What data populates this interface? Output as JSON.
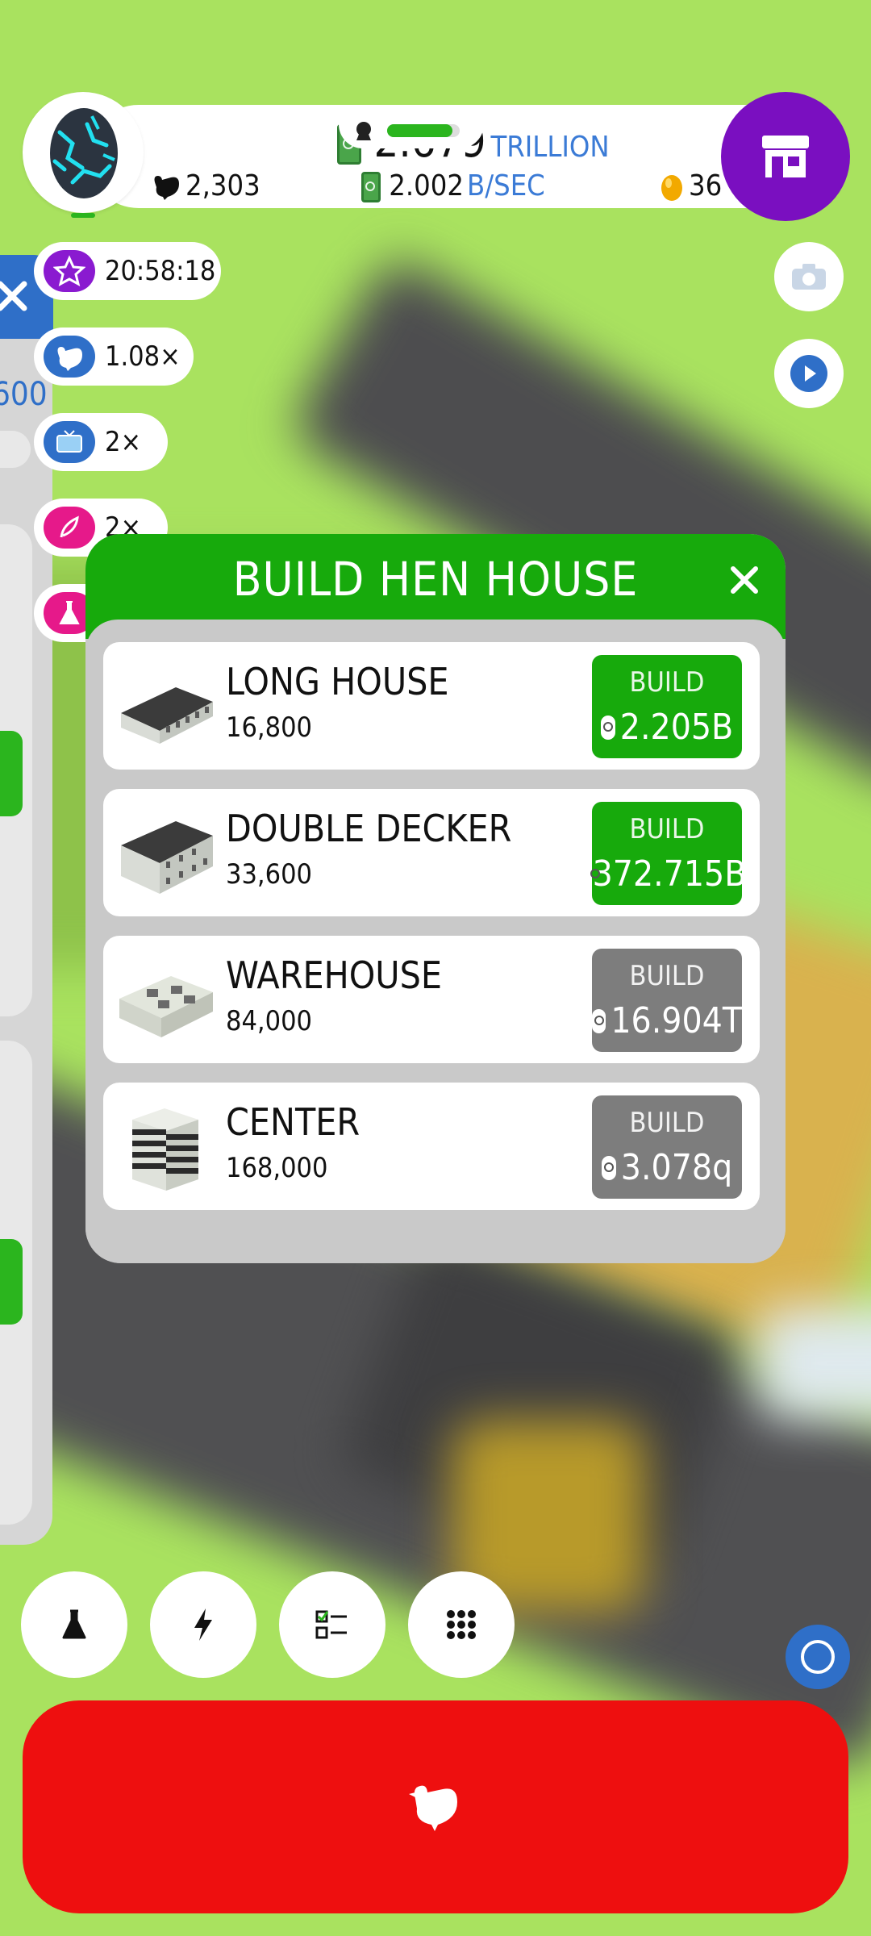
{
  "hud": {
    "money": "2.679",
    "money_unit": "TRILLION",
    "rate": "2.002",
    "rate_unit": "B/SEC",
    "chickens": "2,303",
    "golden_eggs": "36",
    "hab_fill_fraction": 0.9
  },
  "boosts": [
    {
      "name": "star-boost",
      "value": "20:58:18",
      "color": "#8a1ad0"
    },
    {
      "name": "chicken-boost",
      "value": "1.08×",
      "color": "#2f6fc8"
    },
    {
      "name": "tv-boost",
      "value": "2×",
      "color": "#2f6fc8"
    },
    {
      "name": "feather-boost",
      "value": "2×",
      "color": "#e6198a"
    }
  ],
  "left_panel": {
    "close_label": "✕",
    "value_text": "600"
  },
  "dialog": {
    "title": "BUILD HEN HOUSE",
    "items": [
      {
        "name": "LONG HOUSE",
        "capacity": "16,800",
        "button_label": "BUILD",
        "price": "2.205B",
        "affordable": true
      },
      {
        "name": "DOUBLE DECKER",
        "capacity": "33,600",
        "button_label": "BUILD",
        "price": "372.715B",
        "affordable": true
      },
      {
        "name": "WAREHOUSE",
        "capacity": "84,000",
        "button_label": "BUILD",
        "price": "16.904T",
        "affordable": false
      },
      {
        "name": "CENTER",
        "capacity": "168,000",
        "button_label": "BUILD",
        "price": "3.078q",
        "affordable": false
      }
    ]
  },
  "colors": {
    "accent_green": "#17aa0c",
    "disabled_gray": "#7d7d7d",
    "shop_purple": "#7a0fc0",
    "hatch_red": "#ee0f0f",
    "bg_green": "#a9e25f"
  },
  "icons": {
    "shop": "shop-icon",
    "camera": "camera-icon",
    "play": "play-icon",
    "research": "flask-icon",
    "boosts": "lightning-icon",
    "missions": "checklist-icon",
    "menu": "grid-icon",
    "hatch": "chicken-icon"
  }
}
